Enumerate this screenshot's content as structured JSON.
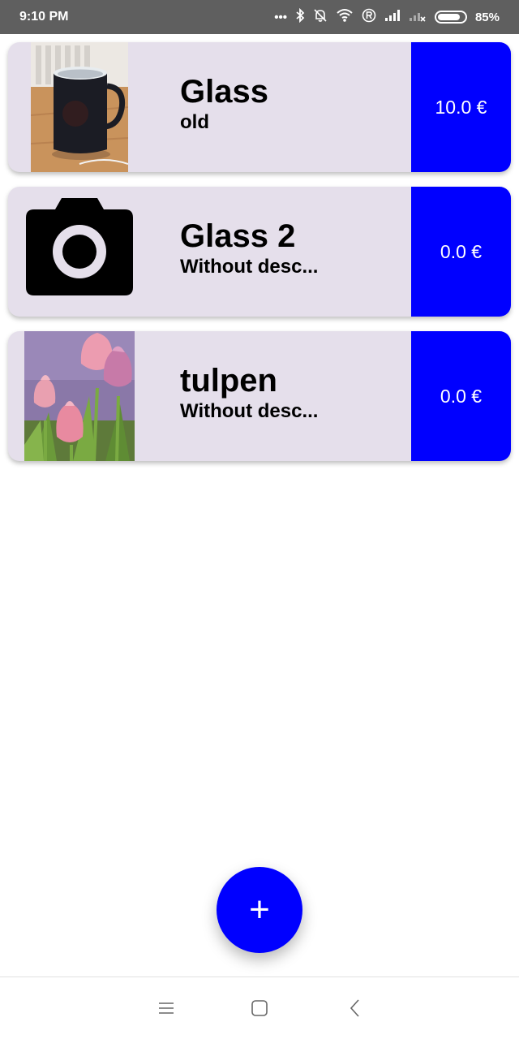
{
  "status_bar": {
    "time": "9:10 PM",
    "battery_text": "85%",
    "battery_level": 0.85,
    "icons": [
      "dots-icon",
      "bluetooth-icon",
      "bell-off-icon",
      "wifi-icon",
      "registered-icon",
      "signal-icon",
      "signal-no-sim-icon",
      "battery-icon"
    ]
  },
  "items": [
    {
      "title": "Glass",
      "description": "old",
      "price": "10.0 €",
      "thumbnail": "mug-photo"
    },
    {
      "title": "Glass 2",
      "description": "Without desc...",
      "price": "0.0 €",
      "thumbnail": "camera-icon"
    },
    {
      "title": "tulpen",
      "description": "Without desc...",
      "price": "0.0 €",
      "thumbnail": "tulips-photo"
    }
  ],
  "fab": {
    "icon": "plus-icon",
    "symbol": "+"
  },
  "nav_bar": {
    "icons": [
      "menu-icon",
      "home-square-icon",
      "back-chevron-icon"
    ]
  },
  "colors": {
    "accent": "#0000ff",
    "card_bg": "#e5dfeb",
    "status_bar_bg": "#5f5f5f"
  }
}
